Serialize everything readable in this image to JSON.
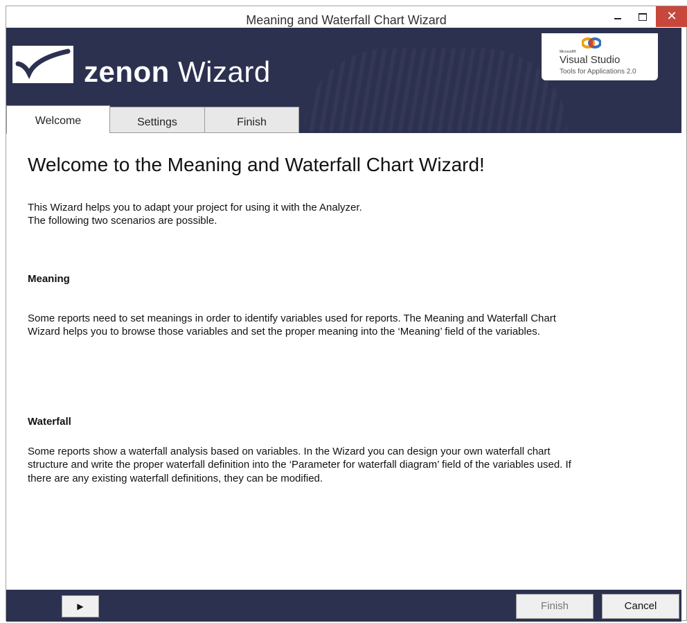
{
  "window": {
    "title": "Meaning and Waterfall Chart Wizard",
    "controls": {
      "minimize": "minimize-icon",
      "maximize": "maximize-icon",
      "close": "close-icon",
      "close_glyph": "✕"
    }
  },
  "header": {
    "logo_icon": "zenon-logo-icon",
    "title_bold": "zenon",
    "title_rest": " Wizard",
    "badge": {
      "microsoft": "Microsoft®",
      "product": "Visual Studio",
      "subtitle": "Tools for Applications 2.0"
    }
  },
  "tabs": [
    {
      "label": "Welcome",
      "active": true
    },
    {
      "label": "Settings",
      "active": false
    },
    {
      "label": "Finish",
      "active": false
    }
  ],
  "content": {
    "heading": "Welcome to the Meaning and Waterfall Chart Wizard!",
    "intro_line1": "This  Wizard helps you to adapt your project for using it with the Analyzer.",
    "intro_line2": "The following two scenarios are possible.",
    "meaning_title": "Meaning",
    "meaning_line1": "Some reports need to set meanings in order to identify variables used for reports. The Meaning and Waterfall Chart",
    "meaning_line2": " Wizard helps you to browse those variables and set the proper meaning into the ‘Meaning’ field of the variables.",
    "waterfall_title": "Waterfall",
    "waterfall_line1": "Some reports show a waterfall analysis based on variables. In the Wizard you can design your own waterfall chart",
    "waterfall_line2": "structure and write the proper waterfall definition into the ‘Parameter for waterfall diagram’ field of the variables used. If",
    "waterfall_line3": "there are any existing waterfall definitions, they can be modified."
  },
  "footer": {
    "next_glyph": "▶",
    "finish_label": "Finish",
    "finish_enabled": false,
    "cancel_label": "Cancel"
  },
  "colors": {
    "header_bg": "#2d3150",
    "close_bg": "#c7473c"
  }
}
